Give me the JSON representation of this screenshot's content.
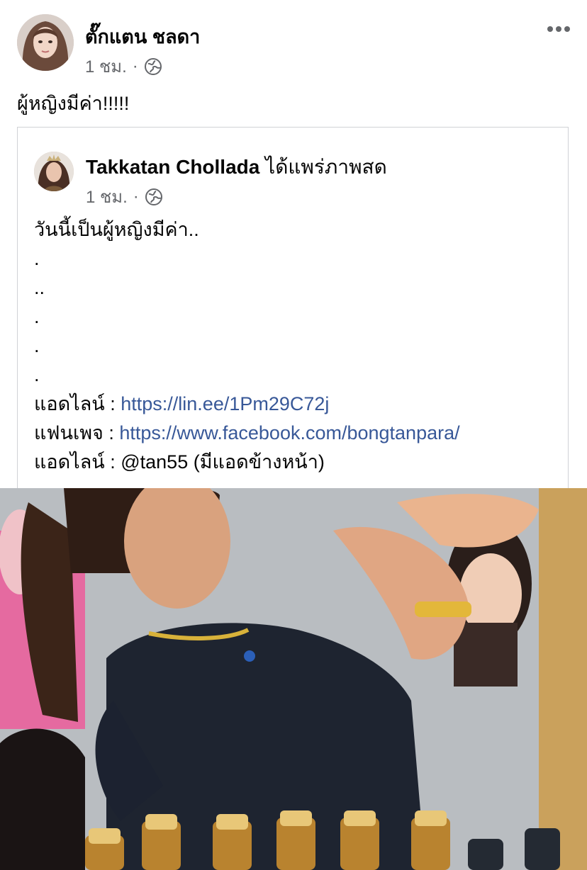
{
  "post": {
    "author": "ตั๊กแตน ชลดา",
    "time": "1 ชม.",
    "separator": "·",
    "privacy_icon": "globe-icon",
    "more_icon": "more-options-icon",
    "text": "ผู้หญิงมีค่า!!!!!"
  },
  "shared": {
    "author": "Takkatan Chollada",
    "action": "ได้แพร่ภาพสด",
    "time": "1 ชม.",
    "separator": "·",
    "privacy_icon": "globe-icon",
    "caption": "วันนี้เป็นผู้หญิงมีค่า..",
    "dots": [
      ".",
      "..",
      ".",
      ".",
      "."
    ],
    "line_label": "แอดไลน์ : ",
    "line_url": "https://lin.ee/1Pm29C72j",
    "fanpage_label": "แฟนเพจ : ",
    "fanpage_url": "https://www.facebook.com/bongtanpara/",
    "line_id_text": "แอดไลน์ : @tan55 (มีแอดข้างหน้า)"
  },
  "colors": {
    "link": "#385898",
    "meta": "#65676b",
    "border": "#d0d2d6"
  }
}
